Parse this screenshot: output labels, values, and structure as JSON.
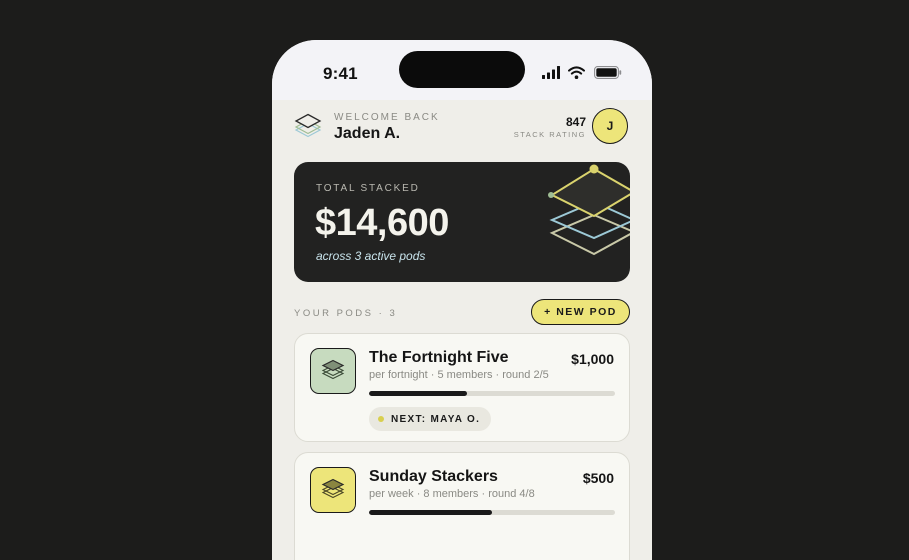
{
  "status_bar": {
    "time": "9:41"
  },
  "header": {
    "welcome": "WELCOME BACK",
    "name": "Jaden A.",
    "rating_value": "847",
    "rating_label": "STACK RATING",
    "avatar_initial": "J"
  },
  "total": {
    "label": "TOTAL STACKED",
    "amount": "$14,600",
    "subtitle": "across 3 active pods"
  },
  "pods_section": {
    "label": "YOUR PODS · 3",
    "new_pod_label": "+ NEW POD"
  },
  "pods": [
    {
      "name": "The Fortnight Five",
      "amount": "$1,000",
      "meta": "per fortnight · 5 members · round 2/5",
      "progress": 0.4,
      "next": "NEXT: MAYA O.",
      "icon": "layers-icon",
      "color": "#c7dbbf"
    },
    {
      "name": "Sunday Stackers",
      "amount": "$500",
      "meta": "per week · 8 members · round 4/8",
      "progress": 0.5,
      "icon": "layers-icon",
      "color": "#ede57a"
    }
  ],
  "colors": {
    "accent_yellow": "#ede57a",
    "dark_card": "#222221",
    "sage": "#c7dbbf",
    "light_blue": "#c9e4ec"
  }
}
